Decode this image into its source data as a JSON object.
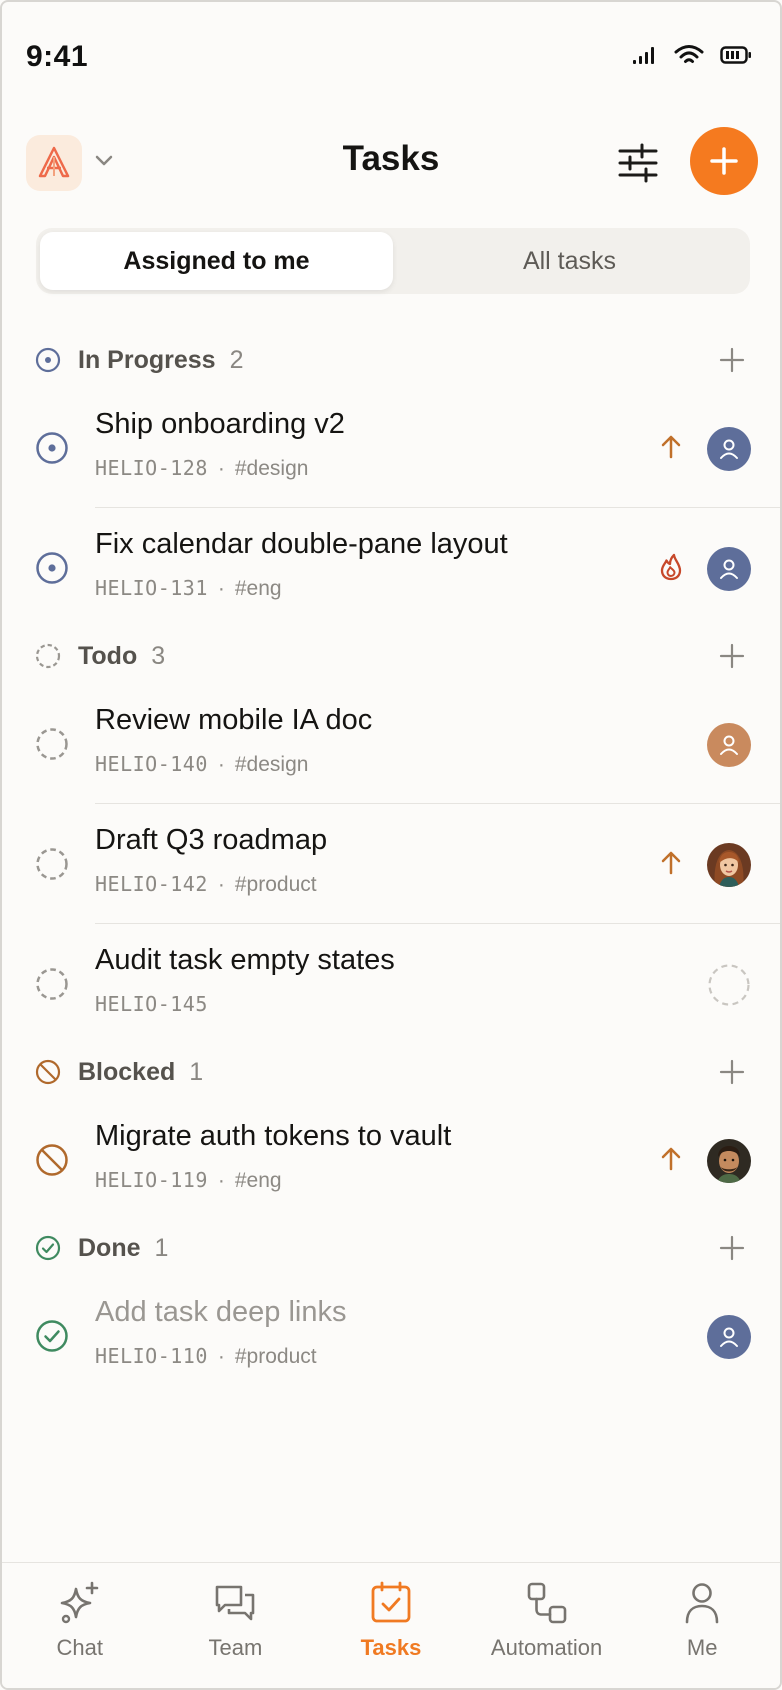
{
  "status_bar": {
    "time": "9:41"
  },
  "header": {
    "title": "Tasks"
  },
  "segments": [
    {
      "label": "Assigned to me",
      "active": true
    },
    {
      "label": "All tasks",
      "active": false
    }
  ],
  "sections": [
    {
      "title": "In Progress",
      "count": "2",
      "icon": "in-progress-icon",
      "tasks": [
        {
          "title": "Ship onboarding v2",
          "id": "HELIO-128",
          "tag": "#design",
          "priority": "high-priority-icon",
          "avatar": "user-icon",
          "avatar_color": "#5E6E9A"
        },
        {
          "title": "Fix calendar double-pane layout",
          "id": "HELIO-131",
          "tag": "#eng",
          "priority": "urgent-flame-icon",
          "avatar": "user-icon",
          "avatar_color": "#5E6E9A"
        }
      ]
    },
    {
      "title": "Todo",
      "count": "3",
      "icon": "todo-icon",
      "tasks": [
        {
          "title": "Review mobile IA doc",
          "id": "HELIO-140",
          "tag": "#design",
          "priority": "",
          "avatar": "user-icon",
          "avatar_color": "#C98A5E"
        },
        {
          "title": "Draft Q3 roadmap",
          "id": "HELIO-142",
          "tag": "#product",
          "priority": "high-priority-icon",
          "avatar": "photo-avatar-woman",
          "avatar_color": "#6B3A22"
        },
        {
          "title": "Audit task empty states",
          "id": "HELIO-145",
          "tag": "",
          "priority": "",
          "avatar": "unassigned-icon",
          "avatar_color": ""
        }
      ]
    },
    {
      "title": "Blocked",
      "count": "1",
      "icon": "blocked-icon",
      "tasks": [
        {
          "title": "Migrate auth tokens to vault",
          "id": "HELIO-119",
          "tag": "#eng",
          "priority": "high-priority-icon",
          "avatar": "photo-avatar-man",
          "avatar_color": "#3A2A1E"
        }
      ]
    },
    {
      "title": "Done",
      "count": "1",
      "icon": "done-icon",
      "tasks": [
        {
          "title": "Add task deep links",
          "id": "HELIO-110",
          "tag": "#product",
          "priority": "",
          "avatar": "user-icon",
          "avatar_color": "#5E6E9A"
        }
      ]
    }
  ],
  "tab_bar": [
    {
      "label": "Chat",
      "icon": "sparkle-icon",
      "active": false
    },
    {
      "label": "Team",
      "icon": "chat-bubbles-icon",
      "active": false
    },
    {
      "label": "Tasks",
      "icon": "task-check-icon",
      "active": true
    },
    {
      "label": "Automation",
      "icon": "workflow-icon",
      "active": false
    },
    {
      "label": "Me",
      "icon": "person-icon",
      "active": false
    }
  ],
  "colors": {
    "accent": "#F57A1F",
    "in_progress": "#5E6E9A",
    "todo": "#9A9792",
    "blocked": "#B0692C",
    "done": "#3F8A60",
    "priority_high": "#C0702A",
    "priority_urgent": "#C7482A"
  }
}
